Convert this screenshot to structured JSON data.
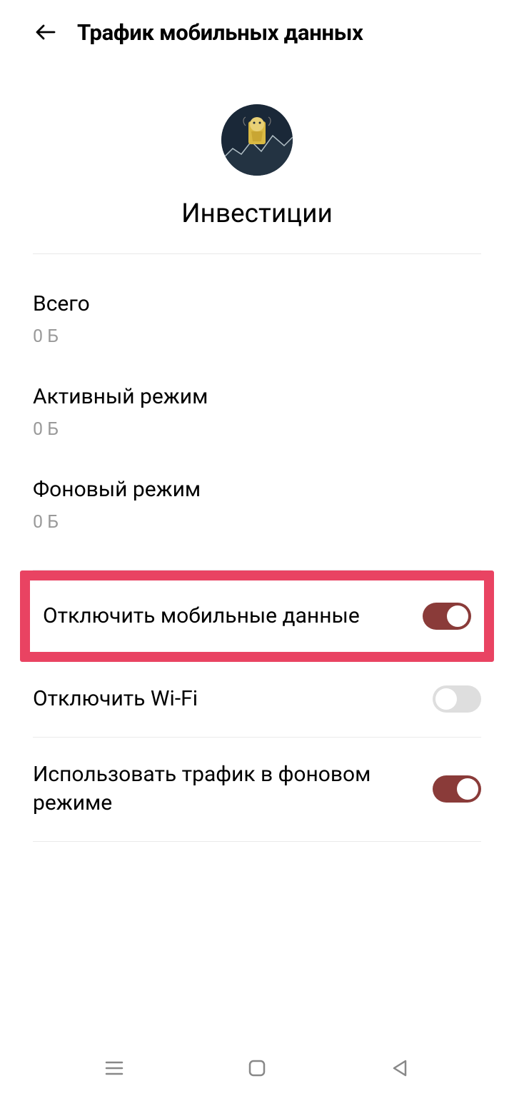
{
  "header": {
    "title": "Трафик мобильных данных"
  },
  "app": {
    "name": "Инвестиции"
  },
  "stats": {
    "total_label": "Всего",
    "total_value": "0 Б",
    "active_label": "Активный режим",
    "active_value": "0 Б",
    "background_label": "Фоновый режим",
    "background_value": "0 Б"
  },
  "toggles": {
    "disable_mobile": {
      "label": "Отключить мобильные данные",
      "state": "on"
    },
    "disable_wifi": {
      "label": "Отключить Wi-Fi",
      "state": "off"
    },
    "background_traffic": {
      "label": "Использовать трафик в фоновом режиме",
      "state": "on"
    }
  }
}
